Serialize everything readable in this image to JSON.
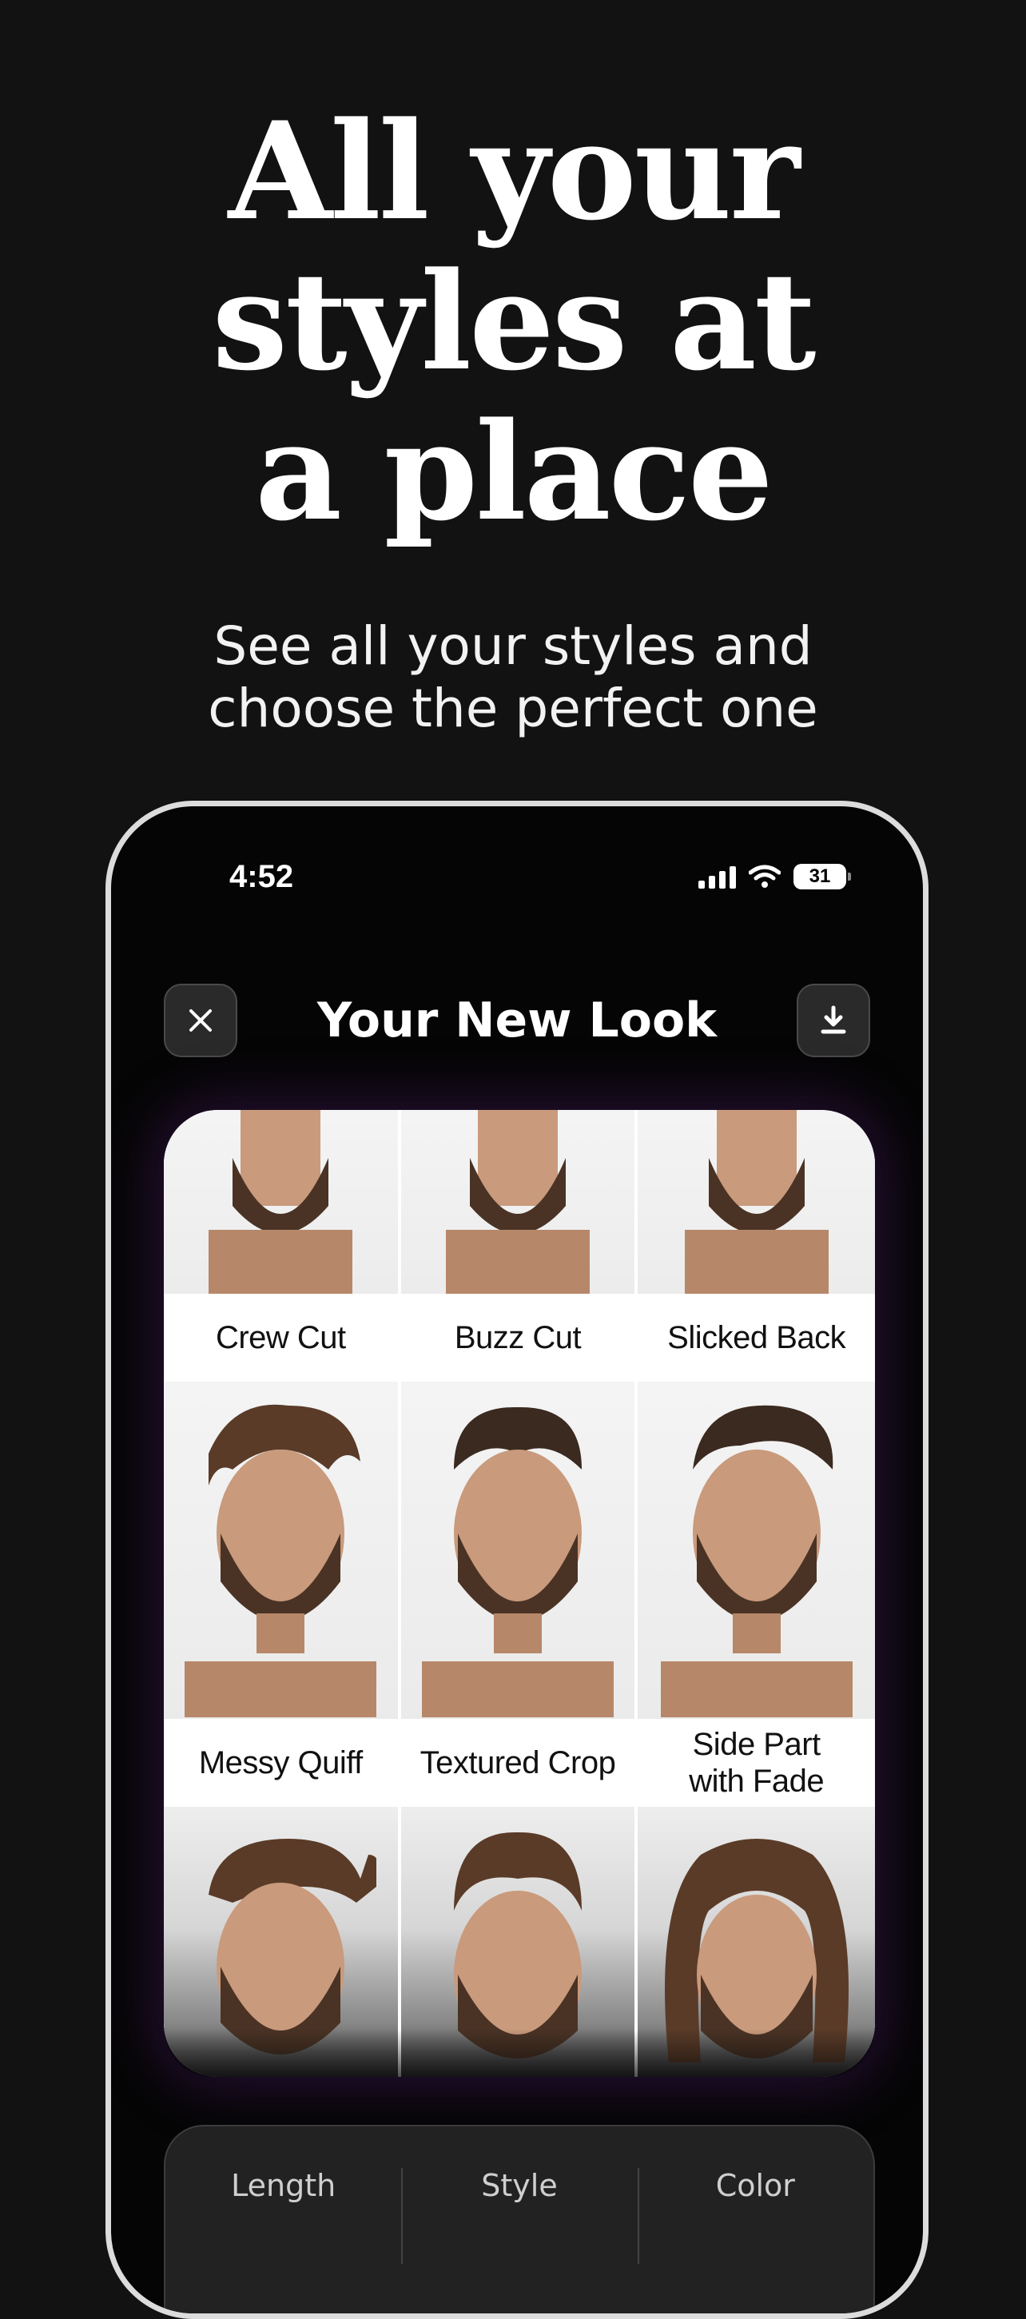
{
  "hero": {
    "title_lines": [
      "All your",
      "styles at",
      "a place"
    ],
    "subtitle_lines": [
      "See all your styles and",
      "choose the perfect one"
    ]
  },
  "status_bar": {
    "time": "4:52",
    "battery": "31",
    "icons": [
      "signal-icon",
      "wifi-icon",
      "battery-icon"
    ]
  },
  "header": {
    "title": "Your New Look",
    "close_icon": "close-icon",
    "download_icon": "download-icon"
  },
  "styles": [
    {
      "label": "Crew Cut"
    },
    {
      "label": "Buzz Cut"
    },
    {
      "label": "Slicked Back"
    },
    {
      "label": "Messy Quiff"
    },
    {
      "label": "Textured Crop"
    },
    {
      "label": "Side Part\nwith Fade"
    },
    {
      "label": ""
    },
    {
      "label": ""
    },
    {
      "label": ""
    }
  ],
  "options": [
    {
      "label": "Length"
    },
    {
      "label": "Style"
    },
    {
      "label": "Color"
    }
  ],
  "colors": {
    "background": "#121212",
    "phone_frame": "#dcdcdc",
    "glow": "#501e6e"
  }
}
